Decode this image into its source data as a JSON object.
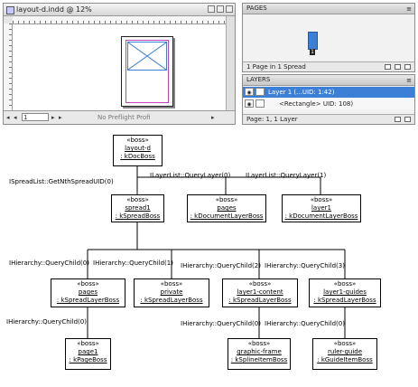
{
  "document_window": {
    "title": "layout-d.indd @ 12%",
    "page_field": "1",
    "preflight_text": "No Preflight Profi"
  },
  "pages_panel": {
    "title": "PAGES",
    "page_number": "1",
    "footer": "1 Page in 1 Spread"
  },
  "layers_panel": {
    "title": "LAYERS",
    "rows": [
      {
        "label": "Layer 1 (...UID: 1:42)"
      },
      {
        "label": "<Rectangle> UID: 108)"
      }
    ],
    "footer": "Page: 1, 1 Layer"
  },
  "diagram": {
    "bosses": [
      {
        "stereotype": "«boss»",
        "name": "layout-d",
        "class": ": kDocBoss"
      },
      {
        "stereotype": "«boss»",
        "name": "spread1",
        "class": ": kSpreadBoss"
      },
      {
        "stereotype": "«boss»",
        "name": "pages",
        "class": ": kDocumentLayerBoss"
      },
      {
        "stereotype": "«boss»",
        "name": "layer1",
        "class": ": kDocumentLayerBoss"
      },
      {
        "stereotype": "«boss»",
        "name": "pages",
        "class": ": kSpreadLayerBoss"
      },
      {
        "stereotype": "«boss»",
        "name": "private",
        "class": ": kSpreadLayerBoss"
      },
      {
        "stereotype": "«boss»",
        "name": "layer1-content",
        "class": ": kSpreadLayerBoss"
      },
      {
        "stereotype": "«boss»",
        "name": "layer1-guides",
        "class": ": kSpreadLayerBoss"
      },
      {
        "stereotype": "«boss»",
        "name": "page1",
        "class": ": kPageBoss"
      },
      {
        "stereotype": "«boss»",
        "name": "graphic-frame",
        "class": ": kSplineItemBoss"
      },
      {
        "stereotype": "«boss»",
        "name": "ruler-guide",
        "class": ": kGuideItemBoss"
      }
    ],
    "labels": [
      "ISpreadList::GetNthSpreadUID(0)",
      "ILayerList::QueryLayer(0)",
      "ILayerList::QueryLayer(1)",
      "IHierarchy::QueryChild(0)",
      "IHierarchy::QueryChild(1)",
      "IHierarchy::QueryChild(2)",
      "IHierarchy::QueryChild(3)",
      "IHierarchy::QueryChild(0)",
      "IHierarchy::QueryChild(0)",
      "IHierarchy::QueryChild(0)"
    ]
  }
}
